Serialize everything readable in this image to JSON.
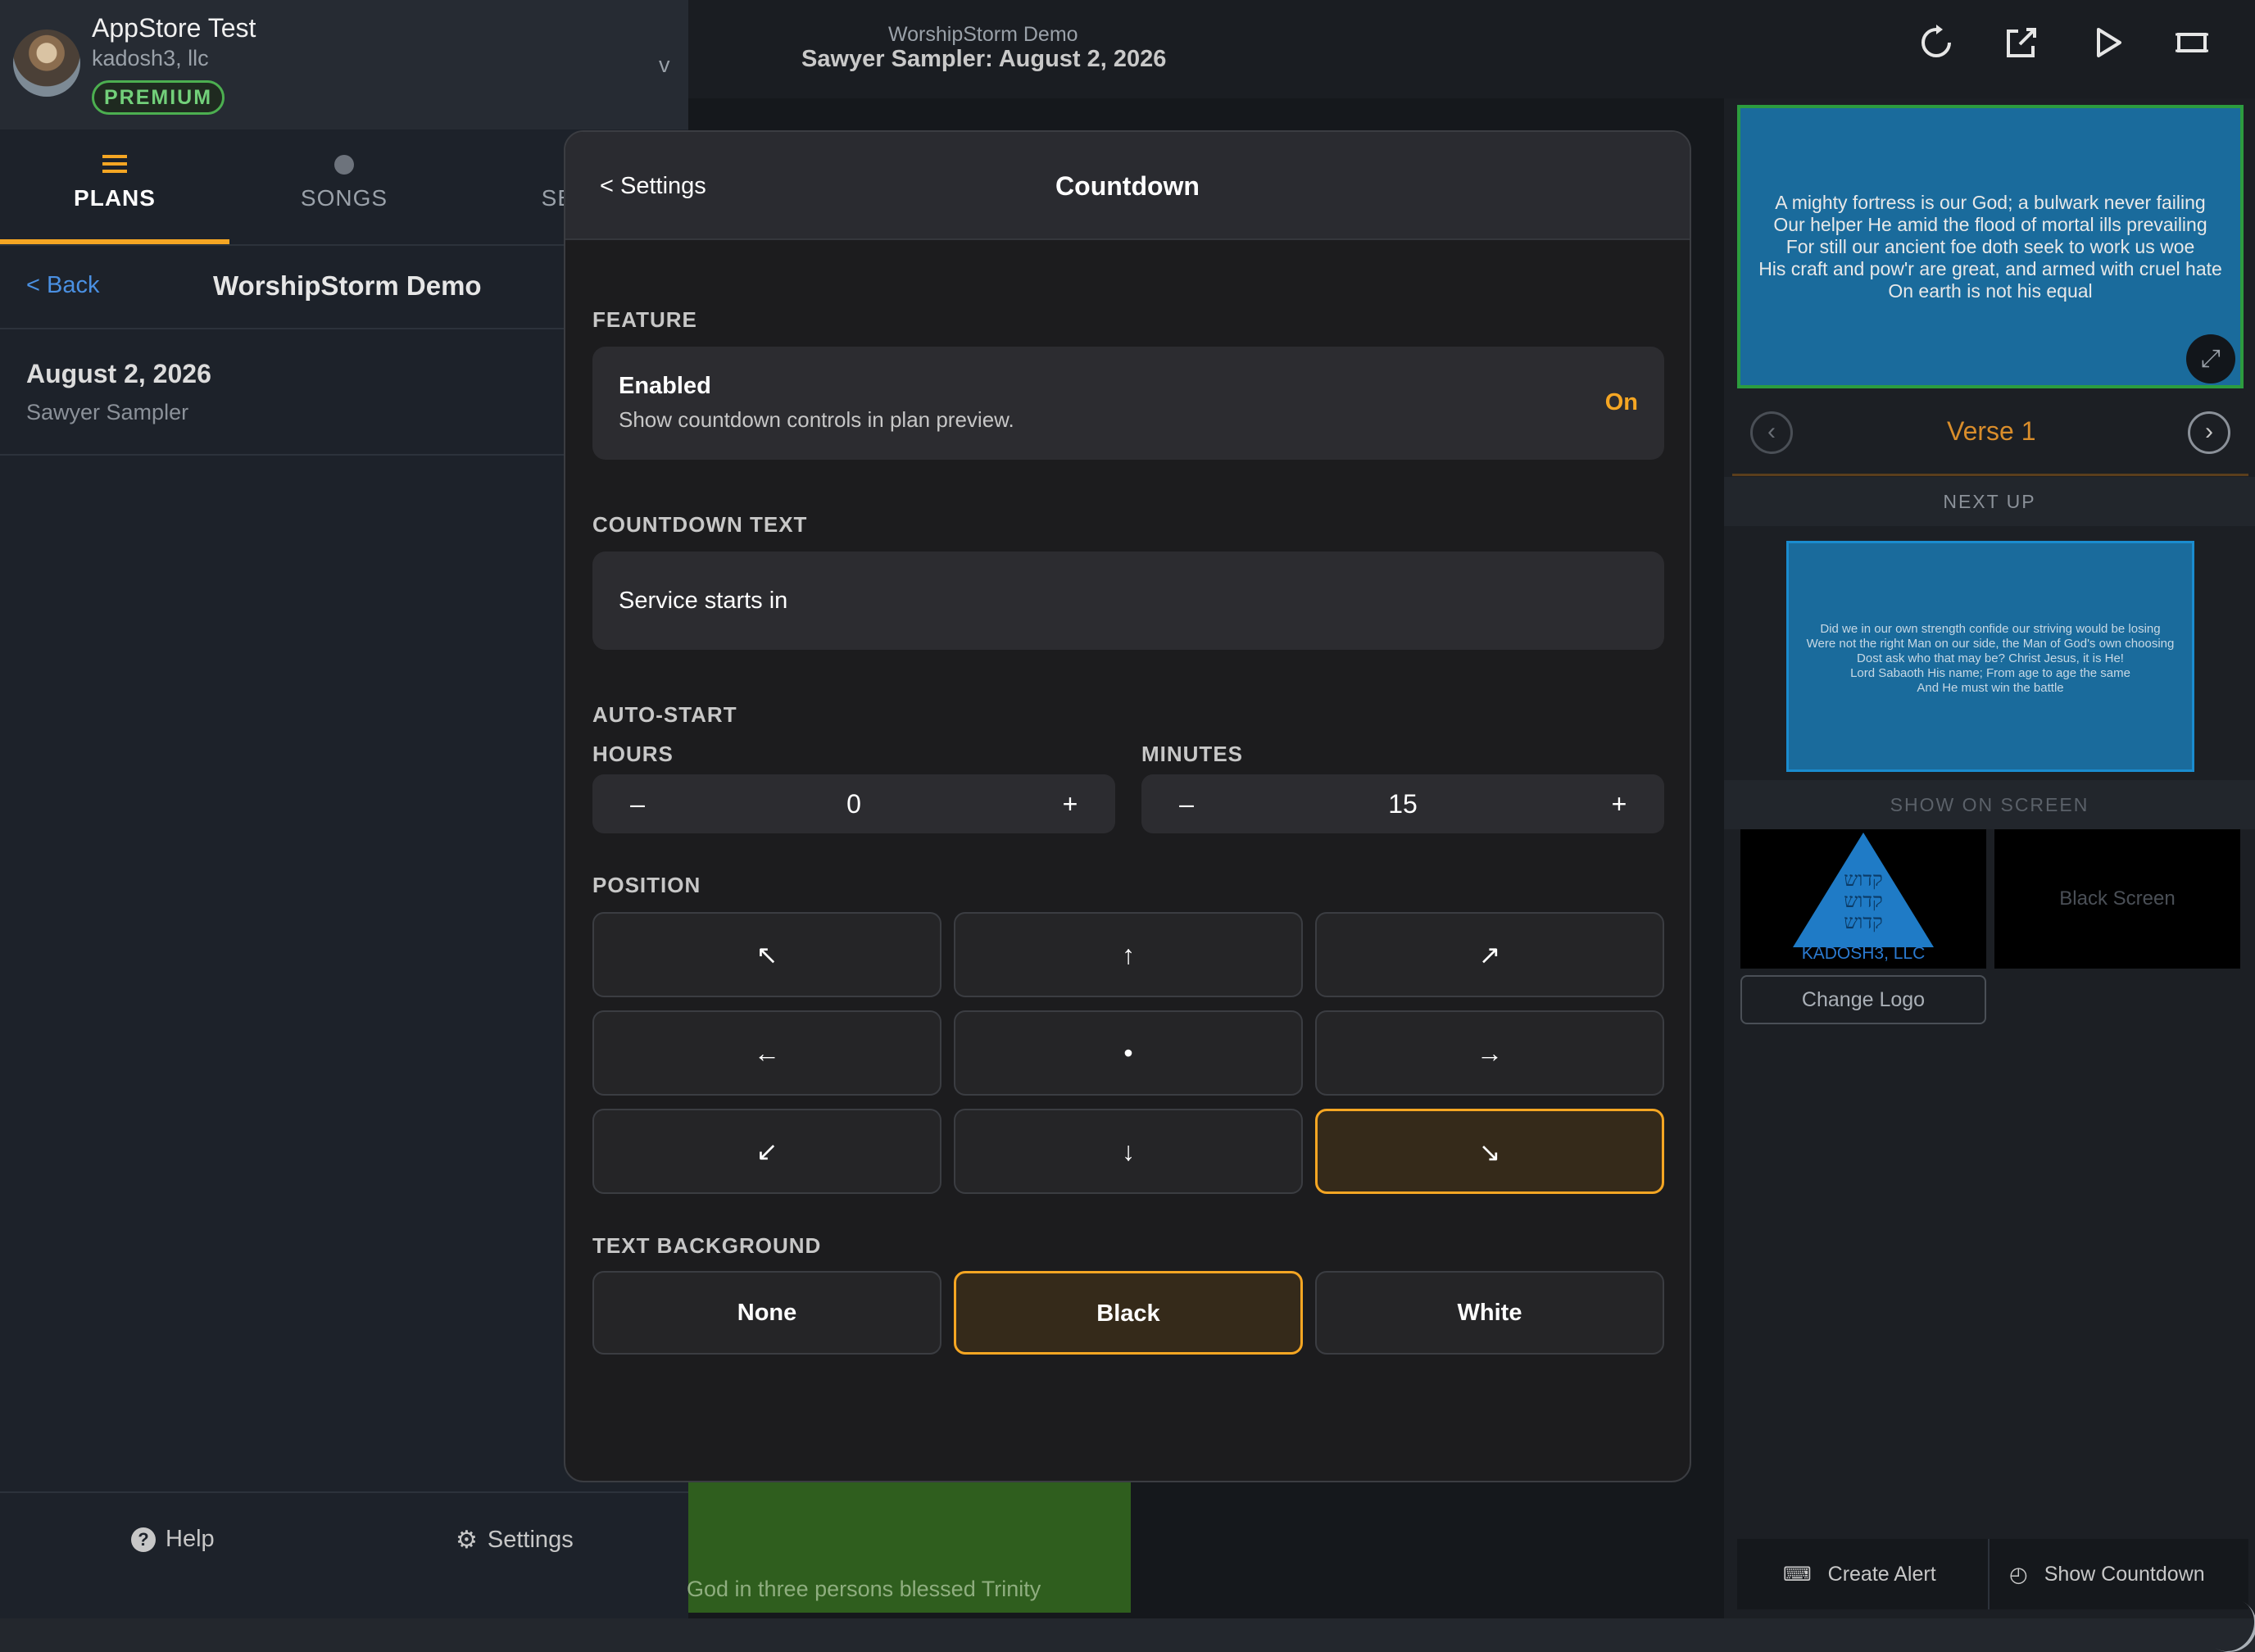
{
  "account": {
    "name": "AppStore Test",
    "org": "kadosh3, llc",
    "badge": "PREMIUM",
    "chevron": "v"
  },
  "tabs": [
    {
      "label": "PLANS",
      "icon": "list-icon",
      "active": true
    },
    {
      "label": "SONGS",
      "icon": "dot-icon",
      "active": false
    },
    {
      "label": "SESS",
      "icon": "",
      "active": false
    }
  ],
  "plan_nav": {
    "back": "< Back",
    "title": "WorshipStorm Demo"
  },
  "plans": [
    {
      "date": "August 2, 2026",
      "name": "Sawyer Sampler"
    }
  ],
  "sidebar_footer": {
    "help": "Help",
    "settings": "Settings"
  },
  "topbar": {
    "subtitle": "WorshipStorm Demo",
    "title": "Sawyer Sampler: August 2, 2026",
    "icons": [
      "refresh-icon",
      "external-edit-icon",
      "play-icon",
      "screen-icon"
    ]
  },
  "center": {
    "green_slide_text": "God in three persons blessed Trinity"
  },
  "right_panel": {
    "live_lines": [
      "A mighty fortress is our God; a bulwark never failing",
      "Our helper He amid the flood of mortal ills prevailing",
      "For still our ancient foe doth seek to work us woe",
      "His craft and pow'r are great, and armed with cruel hate",
      "On earth is not his equal"
    ],
    "verse_label": "Verse 1",
    "next_up_label": "NEXT UP",
    "next_lines": [
      "Did we in our own strength confide our striving would be losing",
      "Were not the right Man on our side, the Man of God's own choosing",
      "Dost ask who that may be? Christ Jesus, it is He!",
      "Lord Sabaoth His name; From age to age the same",
      "And He must win the battle"
    ],
    "show_on_screen_label": "SHOW ON SCREEN",
    "logo_hebrew": [
      "קדוש",
      "קדוש",
      "קדוש"
    ],
    "logo_caption": "KADOSH3, LLC",
    "black_screen": "Black Screen",
    "change_logo": "Change Logo",
    "create_alert": "Create Alert",
    "show_countdown": "Show Countdown"
  },
  "modal": {
    "back": "< Settings",
    "title": "Countdown",
    "feature_label": "FEATURE",
    "enabled_title": "Enabled",
    "enabled_sub": "Show countdown controls in plan preview.",
    "enabled_state": "On",
    "countdown_text_label": "COUNTDOWN TEXT",
    "countdown_text_value": "Service starts in",
    "auto_start_label": "AUTO-START",
    "hours_label": "HOURS",
    "hours_value": "0",
    "minutes_label": "MINUTES",
    "minutes_value": "15",
    "minus": "–",
    "plus": "+",
    "position_label": "POSITION",
    "positions": [
      {
        "glyph": "↖",
        "name": "top-left"
      },
      {
        "glyph": "↑",
        "name": "top-center"
      },
      {
        "glyph": "↗",
        "name": "top-right"
      },
      {
        "glyph": "←",
        "name": "middle-left"
      },
      {
        "glyph": "•",
        "name": "center"
      },
      {
        "glyph": "→",
        "name": "middle-right"
      },
      {
        "glyph": "↙",
        "name": "bottom-left"
      },
      {
        "glyph": "↓",
        "name": "bottom-center"
      },
      {
        "glyph": "↘",
        "name": "bottom-right"
      }
    ],
    "selected_position": "bottom-right",
    "text_bg_label": "TEXT BACKGROUND",
    "text_bg_options": [
      "None",
      "Black",
      "White"
    ],
    "selected_text_bg": "Black"
  },
  "colors": {
    "accent": "#f5a623",
    "link": "#4a90e2",
    "premium": "#4caf50",
    "slide_blue": "#1a6b9c"
  }
}
